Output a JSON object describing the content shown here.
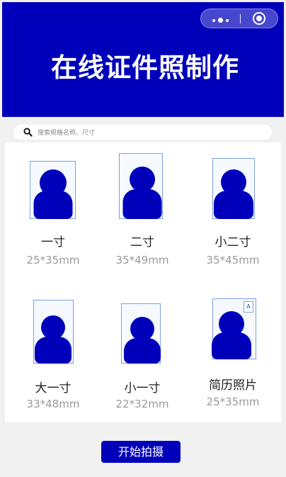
{
  "header": {
    "title": "在线证件照制作",
    "background": "#0000bb"
  },
  "search": {
    "placeholder": "搜索规格名称、尺寸"
  },
  "sizes": [
    {
      "name": "一寸",
      "size": "25*35mm"
    },
    {
      "name": "二寸",
      "size": "35*49mm"
    },
    {
      "name": "小二寸",
      "size": "35*45mm"
    },
    {
      "name": "大一寸",
      "size": "33*48mm"
    },
    {
      "name": "小一寸",
      "size": "22*32mm"
    },
    {
      "name": "简历照片",
      "size": "25*35mm",
      "badge": "A"
    }
  ],
  "action": {
    "start_label": "开始拍摄"
  }
}
